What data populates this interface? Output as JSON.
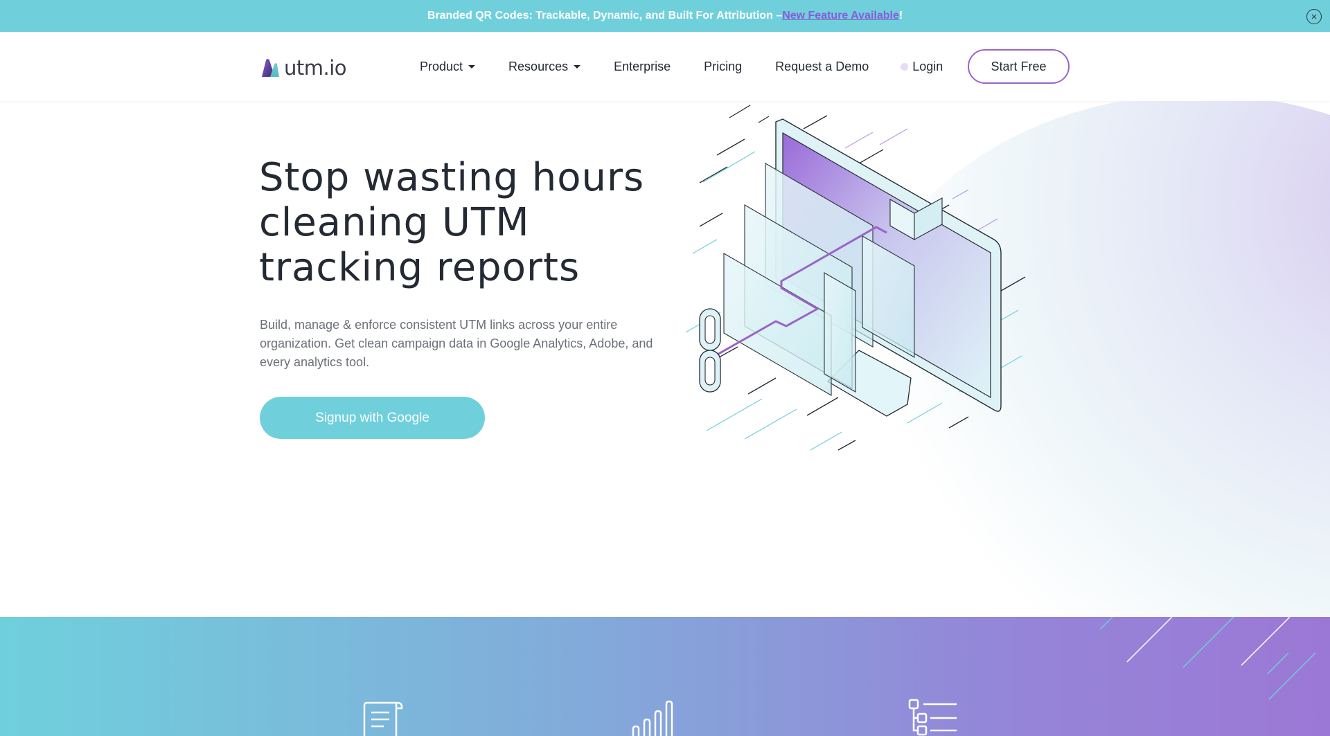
{
  "banner": {
    "text": "Branded QR Codes: Trackable, Dynamic, and Built For Attribution – ",
    "link": "New Feature Available",
    "suffix": "!",
    "close_icon": "close-icon"
  },
  "nav": {
    "logo_text": "utm.io",
    "items": [
      {
        "label": "Product",
        "dropdown": true
      },
      {
        "label": "Resources",
        "dropdown": true
      },
      {
        "label": "Enterprise",
        "dropdown": false
      },
      {
        "label": "Pricing",
        "dropdown": false
      },
      {
        "label": "Request a Demo",
        "dropdown": false
      }
    ],
    "login_label": "Login",
    "start_label": "Start Free"
  },
  "hero": {
    "title_line1": "Stop wasting hours",
    "title_line2": "cleaning UTM",
    "title_line3": "tracking reports",
    "subtitle": "Build, manage & enforce consistent UTM links across your entire organization. Get clean campaign data in Google Analytics, Adobe, and every analytics tool.",
    "cta_label": "Signup with Google"
  },
  "features_band": {
    "icons": [
      "document-scroll-icon",
      "bar-signal-icon",
      "tree-list-icon"
    ]
  },
  "colors": {
    "teal": "#6fd0dc",
    "purple": "#9a63c9",
    "text_dark": "#232a33",
    "text_muted": "#6b6f78"
  }
}
